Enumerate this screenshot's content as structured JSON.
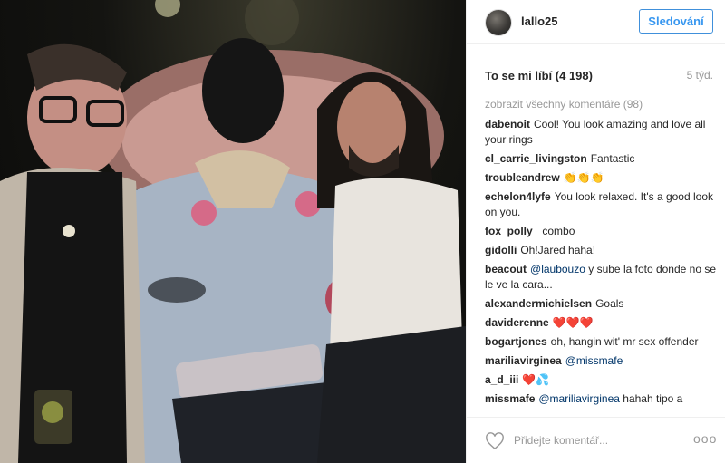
{
  "post": {
    "username": "lallo25",
    "follow_label": "Sledování",
    "likes_text": "To se mi líbí (4 198)",
    "time_ago": "5 týd.",
    "view_all_comments": "zobrazit všechny komentáře (98)",
    "add_comment_placeholder": "Přidejte komentář...",
    "more_glyph": "ooo"
  },
  "comments": [
    {
      "user": "dabenoit",
      "text": "Cool! You look amazing and love all your rings"
    },
    {
      "user": "cl_carrie_livingston",
      "text": "Fantastic"
    },
    {
      "user": "troubleandrew",
      "text": "👏👏👏"
    },
    {
      "user": "echelon4lyfe",
      "text": "You look relaxed. It's a good look on you."
    },
    {
      "user": "fox_polly_",
      "text": "combo"
    },
    {
      "user": "gidolli",
      "text": "Oh!Jared haha!"
    },
    {
      "user": "beacout",
      "mention": "@laubouzo",
      "text": "y sube la foto donde no se le ve la cara..."
    },
    {
      "user": "alexandermichielsen",
      "text": "Goals"
    },
    {
      "user": "daviderenne",
      "text": "❤️❤️❤️"
    },
    {
      "user": "bogartjones",
      "text": "oh, hangin wit' mr sex offender"
    },
    {
      "user": "mariliavirginea",
      "mention": "@missmafe",
      "text": ""
    },
    {
      "user": "a_d_iii",
      "text": "❤️💦"
    },
    {
      "user": "missmafe",
      "mention": "@mariliavirginea",
      "text": "hahah     tipo a"
    }
  ],
  "colors": {
    "accent": "#3897f0",
    "mention": "#003569",
    "muted": "#999999"
  },
  "icons": {
    "like": "heart-outline-icon",
    "more": "more-options-icon"
  }
}
